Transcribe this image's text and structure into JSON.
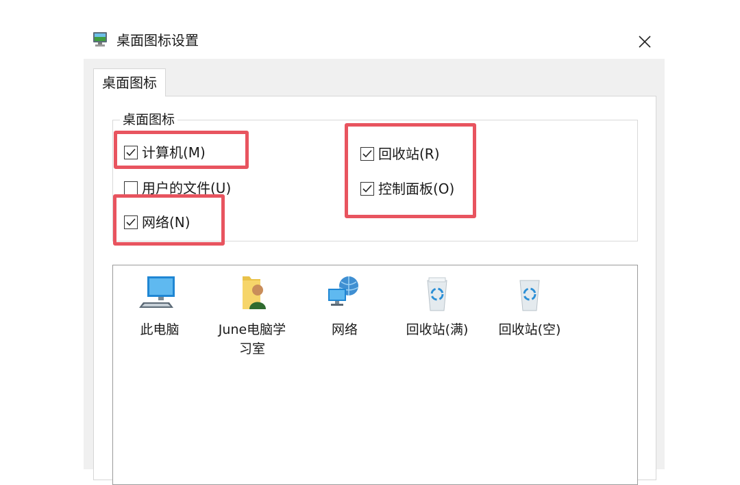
{
  "window": {
    "title": "桌面图标设置",
    "close_symbol": "✕"
  },
  "tabs": [
    {
      "label": "桌面图标",
      "selected": true
    }
  ],
  "group": {
    "legend": "桌面图标",
    "checkboxes": [
      {
        "label": "计算机(M)",
        "checked": true
      },
      {
        "label": "用户的文件(U)",
        "checked": false
      },
      {
        "label": "网络(N)",
        "checked": true
      },
      {
        "label": "回收站(R)",
        "checked": true
      },
      {
        "label": "控制面板(O)",
        "checked": true
      }
    ]
  },
  "icons": [
    {
      "caption": "此电脑",
      "icon": "computer-icon"
    },
    {
      "caption": "June电脑学\n习室",
      "icon": "user-folder-icon"
    },
    {
      "caption": "网络",
      "icon": "network-icon"
    },
    {
      "caption": "回收站(满)",
      "icon": "recycle-bin-full-icon"
    },
    {
      "caption": "回收站(空)",
      "icon": "recycle-bin-empty-icon"
    }
  ],
  "colors": {
    "highlight": "#e8545f",
    "dialog_background": "#f0f0f0",
    "panel_background": "#ffffff"
  }
}
